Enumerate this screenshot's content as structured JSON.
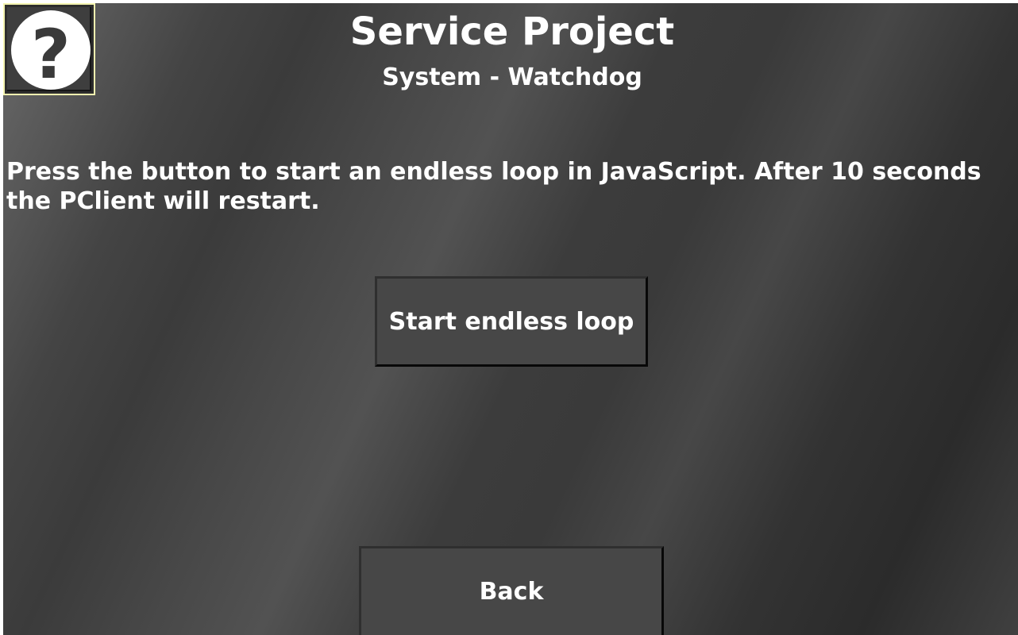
{
  "header": {
    "title": "Service Project",
    "subtitle": "System - Watchdog"
  },
  "help_button": {
    "icon": "help-question-icon",
    "glyph": "?"
  },
  "content": {
    "message": "Press the button to start an endless loop in JavaScript. After 10 seconds the PClient will restart."
  },
  "buttons": {
    "start_label": "Start endless loop",
    "back_label": "Back"
  },
  "colors": {
    "button_face": "#474747",
    "help_border": "#f4f4b0",
    "text": "#ffffff"
  }
}
